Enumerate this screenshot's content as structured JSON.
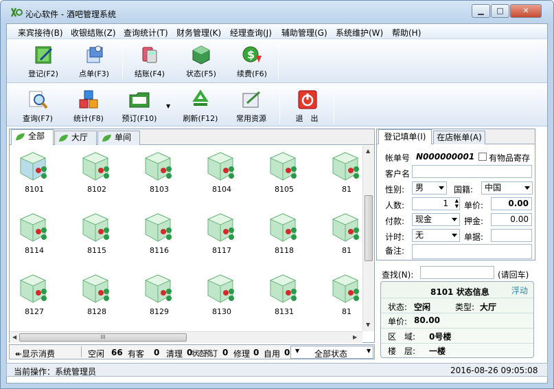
{
  "window": {
    "title": "沁心软件 - 酒吧管理系统",
    "min": "0",
    "max": "1",
    "close": "r"
  },
  "menu": [
    "来宾接待(B)",
    "收银结账(Z)",
    "查询统计(T)",
    "财务管理(K)",
    "经理查询(J)",
    "辅助管理(G)",
    "系统维护(W)",
    "帮助(H)"
  ],
  "toolbar1": [
    "登记(F2)",
    "点单(F3)",
    "结账(F4)",
    "状态(F5)",
    "续费(F6)"
  ],
  "toolbar2": [
    "查询(F7)",
    "统计(F8)",
    "预订(F10)",
    "刷新(F12)",
    "常用资源",
    "退　出"
  ],
  "room_tabs": [
    "全部",
    "大厅",
    "单间"
  ],
  "rooms": [
    [
      "8101",
      "8102",
      "8103",
      "8104",
      "8105",
      "81"
    ],
    [
      "8114",
      "8115",
      "8116",
      "8117",
      "8118",
      "81"
    ],
    [
      "8127",
      "8128",
      "8129",
      "8130",
      "8131",
      "81"
    ]
  ],
  "scroll": {
    "thumb_mark": "III"
  },
  "status_strip": {
    "toggle": "↞显示消费",
    "free_label": "空闲",
    "free_count": "66",
    "occupied_label": "有客",
    "occupied_count": "0",
    "clean_label": "清理",
    "clean_count": "0",
    "reserved_label": "状态预订",
    "reserved_count": "0",
    "repair_label": "修理",
    "repair_count": "0",
    "self_label": "自用",
    "self_count": "0",
    "filter": "全部状态"
  },
  "right_tabs": [
    "登记填单(I)",
    "在店帐单(A)"
  ],
  "form": {
    "bill_label": "帐单号",
    "bill_no": "N000000001",
    "deposit_items": "有物品寄存",
    "customer_label": "客户名",
    "gender_label": "性别:",
    "gender": "男",
    "nation_label": "国籍:",
    "nation": "中国",
    "people_label": "人数:",
    "people": "1",
    "price_label": "单价:",
    "price": "0.00",
    "pay_label": "付款:",
    "pay": "现金",
    "deposit_label": "押金:",
    "deposit": "0.00",
    "timing_label": "计时:",
    "timing": "无",
    "waybill_label": "单据:",
    "note_label": "备注:"
  },
  "search": {
    "label": "查找(N):",
    "hint": "(请回车)"
  },
  "room_info": {
    "title": "8101 状态信息",
    "float": "浮动",
    "status_label": "状态:",
    "status": "空闲",
    "type_label": "类型:",
    "type": "大厅",
    "price_label": "单价:",
    "price": "80.00",
    "area_label": "区　域:",
    "area": "0号楼",
    "floor_label": "楼　层:",
    "floor": "一楼"
  },
  "statusbar": {
    "operation": "当前操作：系统管理员",
    "datetime": "2016-08-26 09:05:08"
  }
}
